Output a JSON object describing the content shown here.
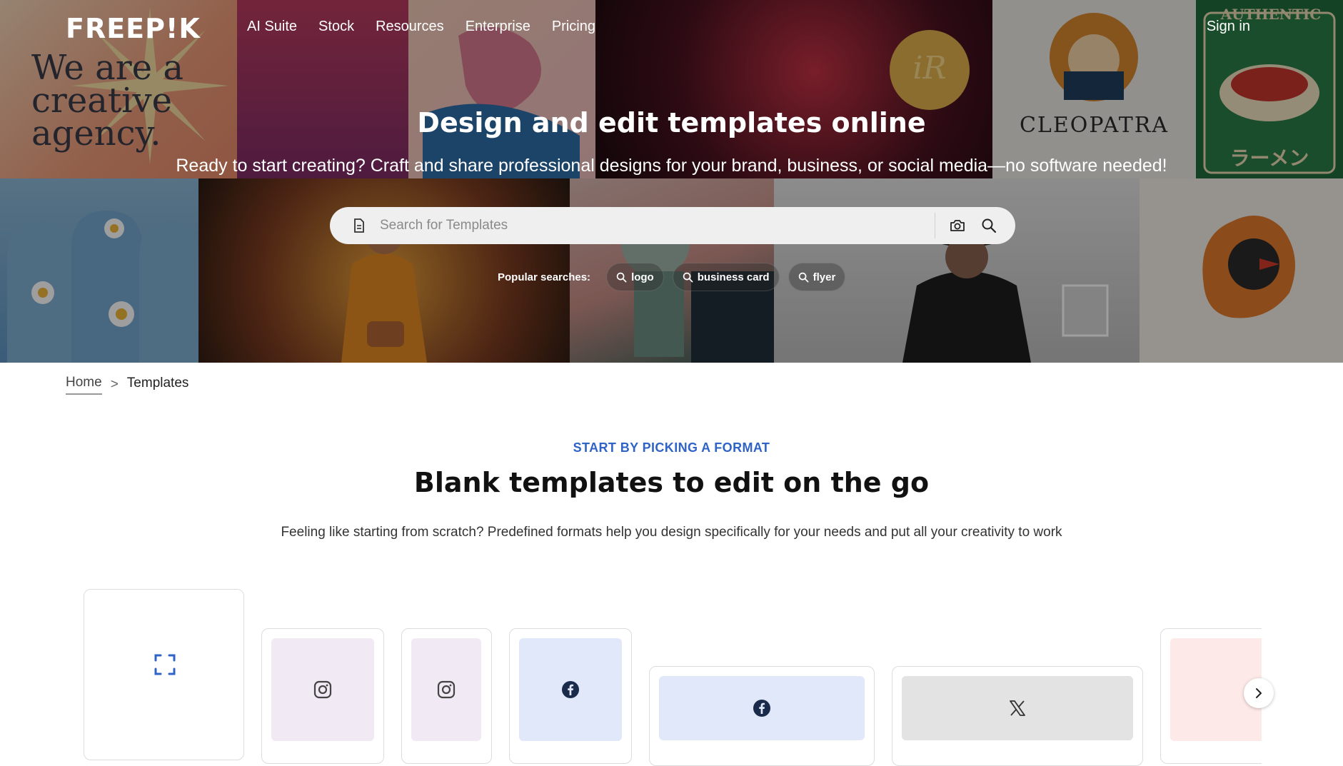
{
  "brand": {
    "logo_text": "FREEP!K"
  },
  "nav": {
    "items": [
      {
        "label": "AI Suite"
      },
      {
        "label": "Stock"
      },
      {
        "label": "Resources"
      },
      {
        "label": "Enterprise"
      },
      {
        "label": "Pricing"
      }
    ],
    "sign_in": "Sign in"
  },
  "hero": {
    "title": "Design and edit templates online",
    "subtitle": "Ready to start creating? Craft and share professional designs for your brand, business, or social media—no software needed!",
    "collage_text": {
      "agency": "We are a creative agency.",
      "cleopatra": "CLEOPATRA",
      "ramen": "ラーメン",
      "authentic": "AUTHENTIC",
      "seal": "iR"
    }
  },
  "search": {
    "placeholder": "Search for Templates",
    "doc_icon": "document-icon",
    "camera_icon": "camera-icon",
    "search_icon": "search-icon"
  },
  "popular": {
    "label": "Popular searches:",
    "chips": [
      {
        "label": "logo"
      },
      {
        "label": "business card"
      },
      {
        "label": "flyer"
      }
    ]
  },
  "breadcrumb": {
    "home": "Home",
    "separator": ">",
    "current": "Templates"
  },
  "section": {
    "eyebrow": "START BY PICKING A FORMAT",
    "title": "Blank templates to edit on the go",
    "description": "Feeling like starting from scratch? Predefined formats help you design specifically for your needs and put all your creativity to work"
  },
  "formats": [
    {
      "icon": "custom-size-icon",
      "bg": "#ffffff"
    },
    {
      "icon": "instagram-icon",
      "bg": "#f1e9f4"
    },
    {
      "icon": "instagram-icon",
      "bg": "#f1e9f4"
    },
    {
      "icon": "facebook-icon",
      "bg": "#e1e8f9"
    },
    {
      "icon": "facebook-icon",
      "bg": "#e1e8f9"
    },
    {
      "icon": "x-icon",
      "bg": "#e3e3e3"
    },
    {
      "icon": "partial-format",
      "bg": "#fde9e7"
    }
  ],
  "colors": {
    "accent": "#2f63c6",
    "text": "#111111"
  }
}
